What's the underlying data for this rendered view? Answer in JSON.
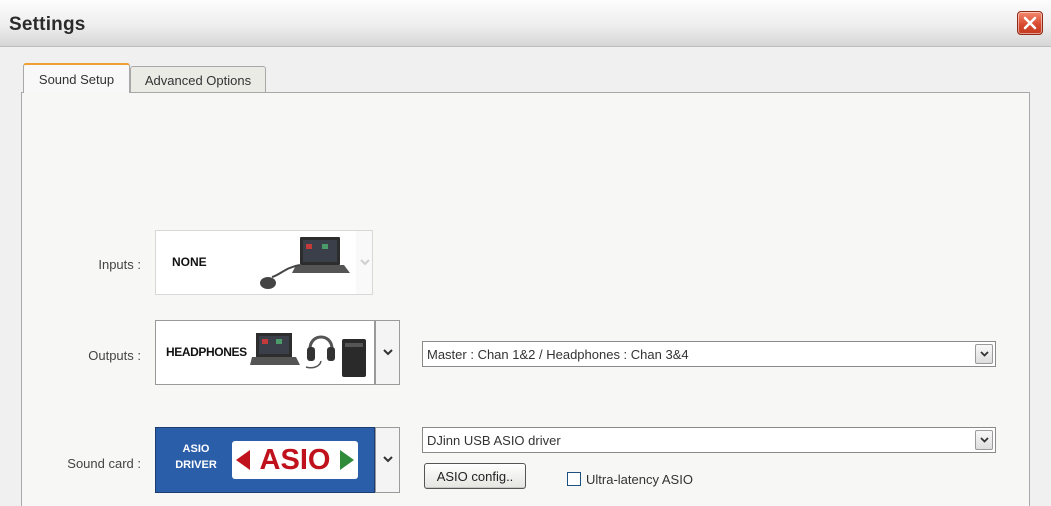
{
  "window": {
    "title": "Settings"
  },
  "tabs": [
    {
      "label": "Sound Setup",
      "active": true
    },
    {
      "label": "Advanced Options",
      "active": false
    }
  ],
  "inputs": {
    "label": "Inputs :",
    "tile_text": "NONE"
  },
  "outputs": {
    "label": "Outputs :",
    "tile_text": "HEADPHONES",
    "routing_value": "Master : Chan 1&2 / Headphones : Chan 3&4"
  },
  "sound_card": {
    "label": "Sound card :",
    "tile_line1": "ASIO",
    "tile_line2": "DRIVER",
    "tile_logo": "ASIO",
    "driver_value": "DJinn USB ASIO driver",
    "config_button": "ASIO config..",
    "ultra_latency_label": "Ultra-latency ASIO",
    "ultra_latency_checked": false
  },
  "colors": {
    "asio_tile": "#2a5ea8",
    "asio_logo": "#c0121c",
    "active_tab_accent": "#f0a030",
    "close_button": "#d7482d"
  },
  "icons": {
    "close": "close-icon",
    "dropdown": "chevron-down-icon",
    "laptop": "laptop-icon",
    "mouse": "mouse-icon",
    "headphones": "headphones-icon",
    "speaker": "speaker-icon"
  }
}
